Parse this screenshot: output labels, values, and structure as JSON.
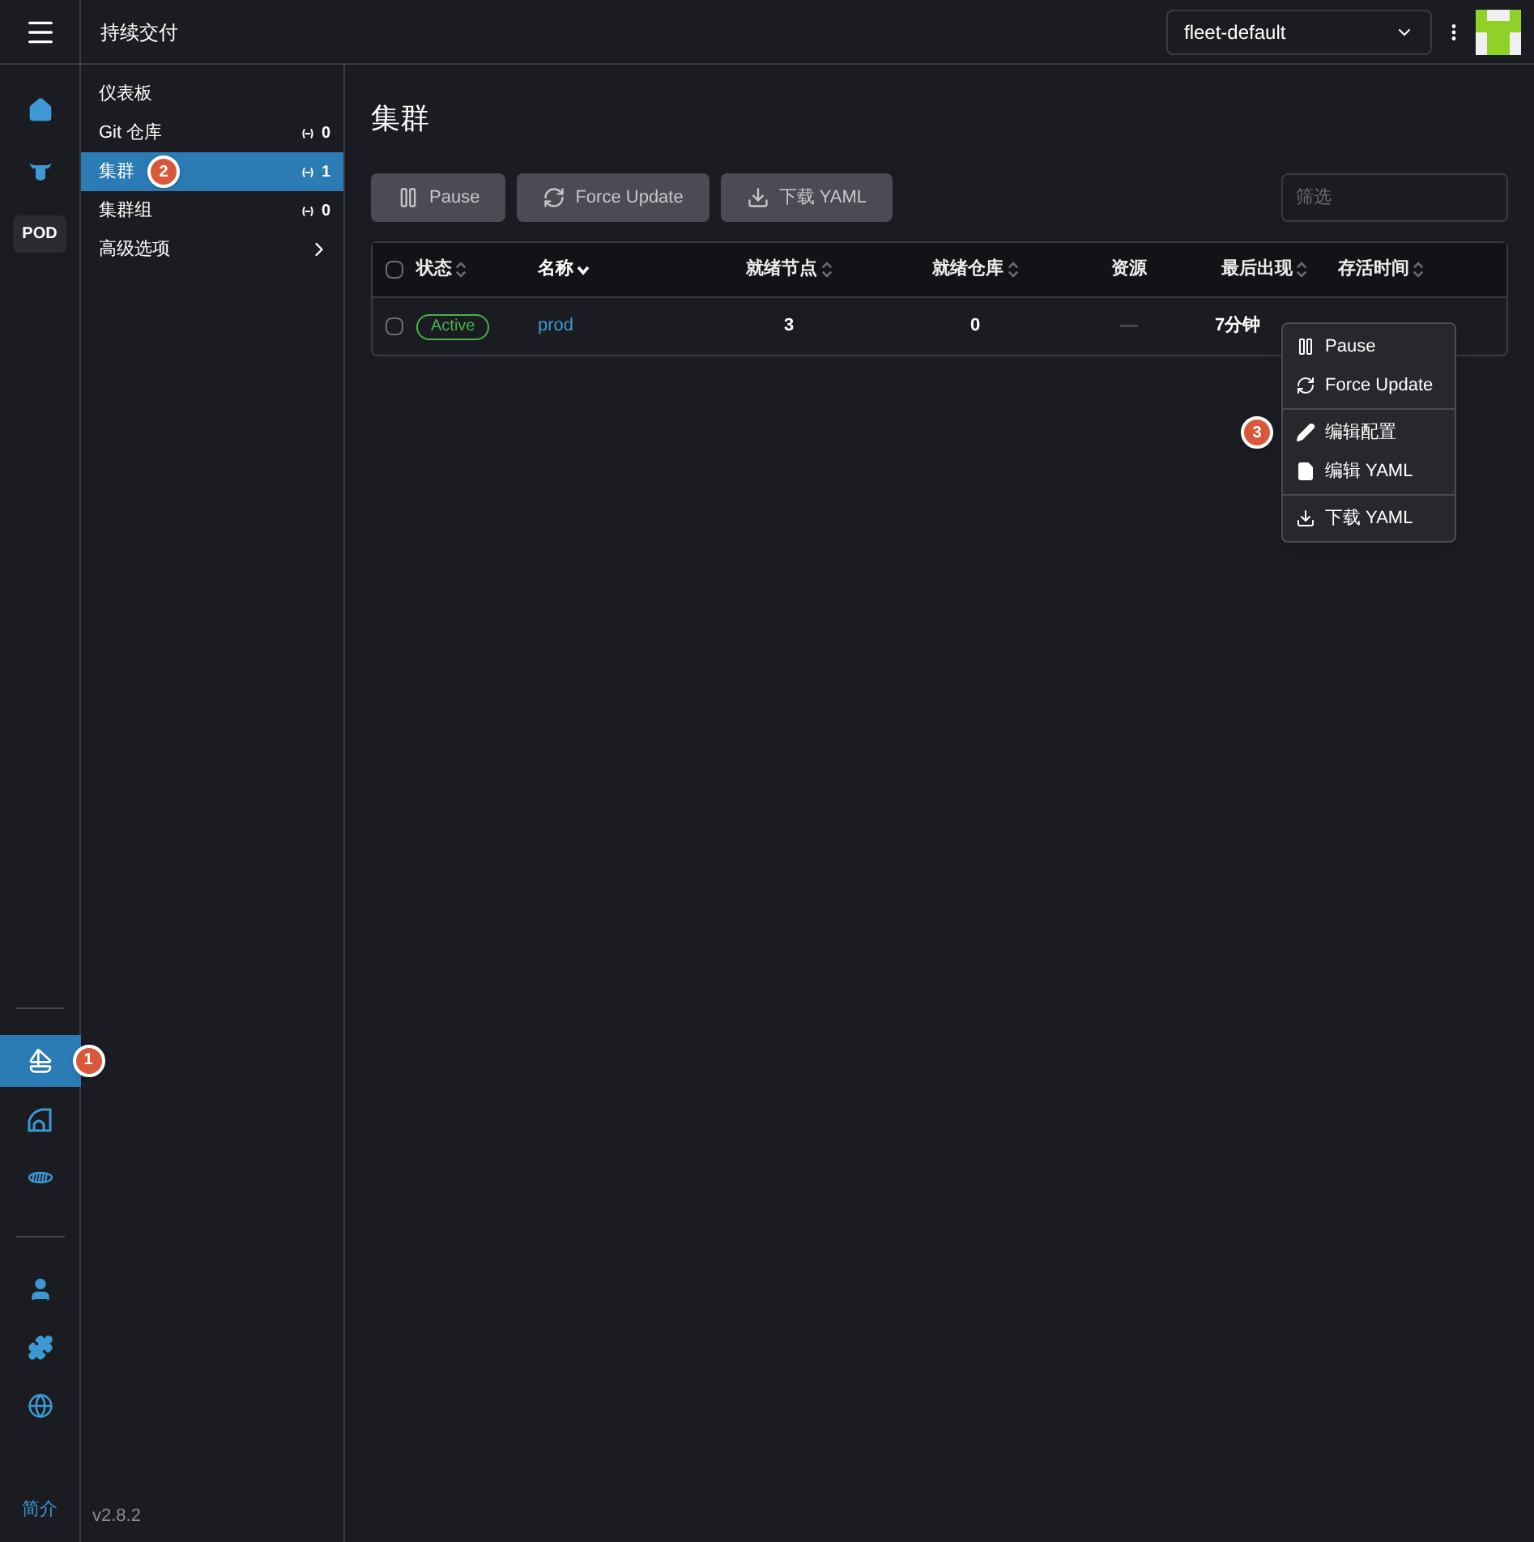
{
  "header": {
    "title": "持续交付",
    "workspace": "fleet-default"
  },
  "rail": {
    "top": [
      {
        "kind": "home",
        "selected": false
      },
      {
        "kind": "cow",
        "selected": false
      },
      {
        "kind": "pod",
        "label": "POD",
        "selected": false
      }
    ],
    "middle": [
      {
        "kind": "sailboat",
        "selected": true,
        "callout": "1"
      },
      {
        "kind": "dome",
        "selected": false
      },
      {
        "kind": "rope",
        "selected": false
      }
    ],
    "bottom": [
      {
        "kind": "user",
        "selected": false
      },
      {
        "kind": "puzzle",
        "selected": false
      },
      {
        "kind": "globe",
        "selected": false
      }
    ],
    "about": "简介"
  },
  "nav": {
    "items": [
      {
        "label": "仪表板",
        "kind": "link",
        "selected": false
      },
      {
        "label": "Git 仓库",
        "kind": "count",
        "count": "0",
        "selected": false
      },
      {
        "label": "集群",
        "kind": "count",
        "count": "1",
        "selected": true,
        "callout": "2"
      },
      {
        "label": "集群组",
        "kind": "count",
        "count": "0",
        "selected": false
      },
      {
        "label": "高级选项",
        "kind": "submenu",
        "selected": false
      }
    ],
    "version": "v2.8.2"
  },
  "page": {
    "title": "集群",
    "buttons": [
      {
        "kind": "pause",
        "label": "Pause"
      },
      {
        "kind": "refresh",
        "label": "Force Update"
      },
      {
        "kind": "download",
        "label": "下载 YAML"
      }
    ],
    "filter": {
      "placeholder": "筛选"
    }
  },
  "table": {
    "all_checked": false,
    "columns": [
      {
        "label": "状态",
        "sortable": true,
        "sorted": false
      },
      {
        "label": "名称",
        "sortable": true,
        "sorted": true
      },
      {
        "label": "就绪节点",
        "sortable": true,
        "sorted": false
      },
      {
        "label": "就绪仓库",
        "sortable": true,
        "sorted": false
      },
      {
        "label": "资源",
        "sortable": false,
        "sorted": false
      },
      {
        "label": "最后出现",
        "sortable": true,
        "sorted": false
      },
      {
        "label": "存活时间",
        "sortable": true,
        "sorted": false
      }
    ],
    "rows": [
      {
        "checked": false,
        "state": "Active",
        "name": "prod",
        "ready_nodes": "3",
        "ready_repos": "0",
        "resources": "—",
        "last_seen": "7分钟"
      }
    ]
  },
  "menu": {
    "groups": [
      [
        {
          "kind": "pause",
          "label": "Pause"
        },
        {
          "kind": "refresh",
          "label": "Force Update"
        }
      ],
      [
        {
          "kind": "pencil",
          "label": "编辑配置",
          "callout": "3"
        },
        {
          "kind": "file",
          "label": "编辑 YAML"
        }
      ],
      [
        {
          "kind": "download",
          "label": "下载 YAML"
        }
      ]
    ]
  }
}
